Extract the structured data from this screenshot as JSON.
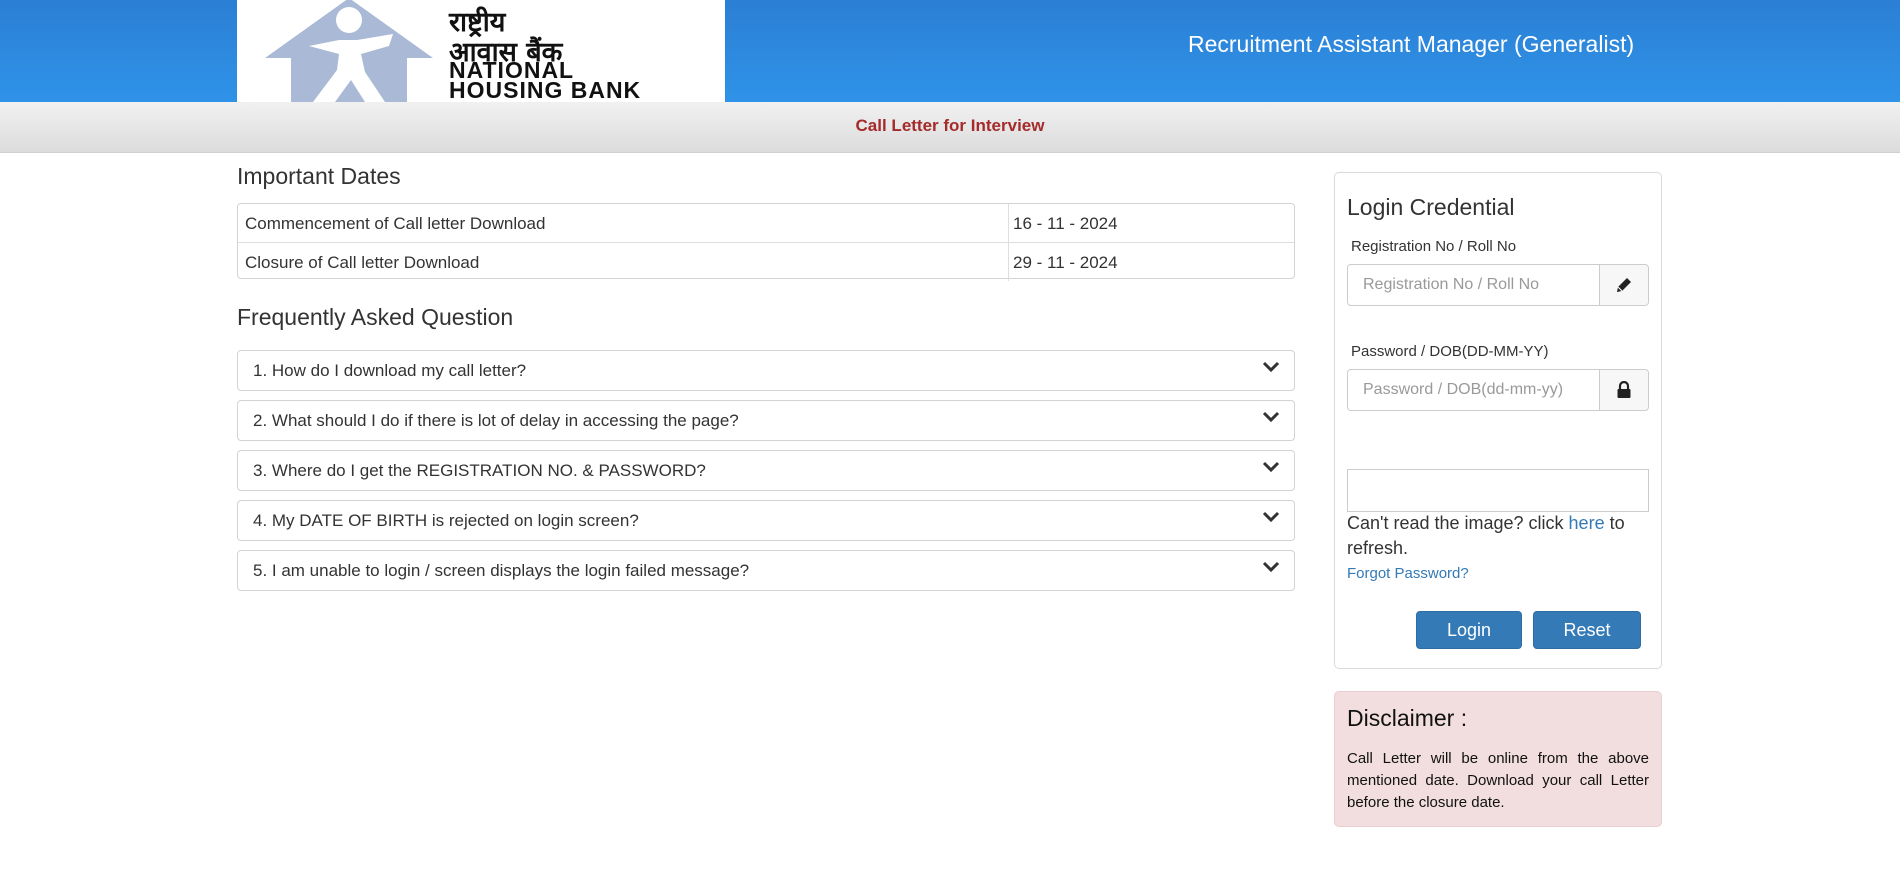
{
  "header": {
    "logo": {
      "hindi_text": "राष्ट्रीय\nआवास बैंक",
      "english_text": "NATIONAL\nHOUSING BANK"
    },
    "title": "Recruitment Assistant Manager (Generalist)"
  },
  "subheader": {
    "title": "Call Letter for Interview"
  },
  "important_dates": {
    "heading": "Important Dates",
    "rows": [
      {
        "label": "Commencement of Call letter Download",
        "value": "16 - 11 - 2024"
      },
      {
        "label": "Closure of Call letter Download",
        "value": "29 - 11 - 2024"
      }
    ]
  },
  "faq": {
    "heading": "Frequently Asked Question",
    "items": [
      {
        "question": "1. How do I download my call letter?"
      },
      {
        "question": "2. What should I do if there is lot of delay in accessing the page?"
      },
      {
        "question": "3. Where do I get the REGISTRATION NO. & PASSWORD?"
      },
      {
        "question": "4. My DATE OF BIRTH is rejected on login screen?"
      },
      {
        "question": "5. I am unable to login / screen displays the login failed message?"
      }
    ],
    "icon": "chevron-down-icon"
  },
  "login": {
    "heading": "Login Credential",
    "registration": {
      "label": "Registration No / Roll No",
      "placeholder": "Registration No / Roll No",
      "value": "",
      "icon": "pencil-icon"
    },
    "password": {
      "label": "Password / DOB(DD-MM-YY)",
      "placeholder": "Password / DOB(dd-mm-yy)",
      "value": "",
      "icon": "lock-icon"
    },
    "captcha_prefix": "Can't read the image? click ",
    "captcha_link": "here",
    "captcha_suffix": " to refresh.",
    "forgot_password": "Forgot Password?",
    "login_button": "Login",
    "reset_button": "Reset"
  },
  "disclaimer": {
    "title": "Disclaimer :",
    "text": "Call Letter will be online from the above mentioned date. Download your call Letter before the closure date."
  },
  "colors": {
    "header_blue": "#2f93e8",
    "subheader_title": "#a52a2a",
    "button_blue": "#337ab7",
    "link": "#337ab7",
    "disclaimer_bg": "#f2dede"
  }
}
